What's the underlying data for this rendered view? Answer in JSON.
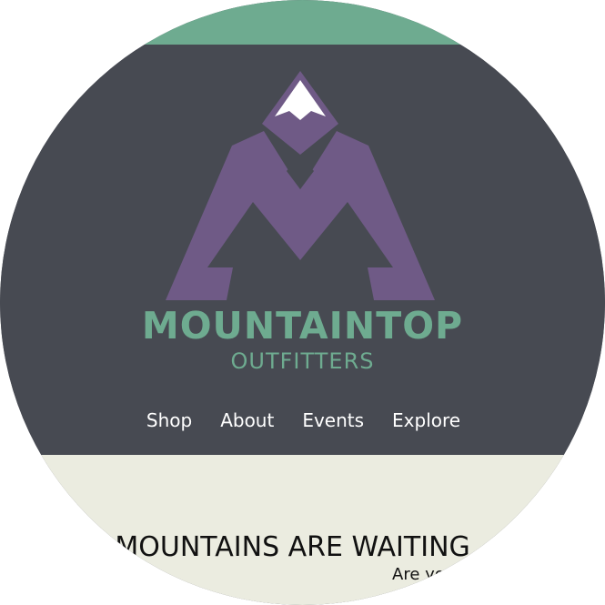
{
  "brand": {
    "name": "MOUNTAINTOP",
    "subtitle": "OUTFITTERS",
    "logo_icon": "mountain-logo-icon"
  },
  "nav": {
    "items": [
      {
        "label": "Shop"
      },
      {
        "label": "About"
      },
      {
        "label": "Events"
      },
      {
        "label": "Explore"
      }
    ]
  },
  "hero": {
    "headline": "THE MOUNTAINS ARE WAITING",
    "subline": "Are you ready?"
  },
  "colors": {
    "top_strip": "#6eab90",
    "header_background": "#474a52",
    "logo_purple": "#6f5a86",
    "brand_green": "#6eab90",
    "hero_background": "#ebece0"
  }
}
